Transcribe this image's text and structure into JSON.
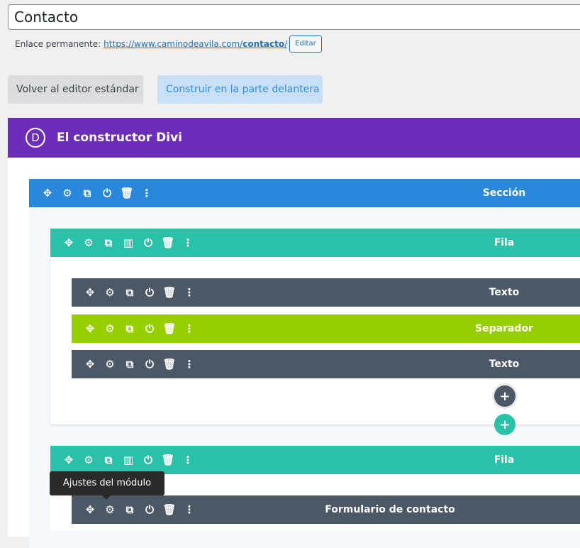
{
  "page_title": "Contacto",
  "permalink": {
    "label": "Enlace permanente:",
    "url_base": "https://www.caminodeavila.com/",
    "url_slug": "contacto",
    "url_end": "/",
    "edit_label": "Editar"
  },
  "buttons": {
    "standard_editor": "Volver al editor estándar",
    "front_builder": "Construir en la parte delantera"
  },
  "divi": {
    "logo_letter": "D",
    "title": "El constructor Divi",
    "section_label": "Sección",
    "row1_label": "Fila",
    "modules": [
      "Texto",
      "Separador",
      "Texto"
    ],
    "add_module": "+",
    "add_row": "+",
    "row2_label": "Fila",
    "tooltip": "Ajustes del módulo",
    "contact_form_label": "Formulario de contacto"
  },
  "icons": {
    "move": "✥",
    "settings": "⚙",
    "duplicate": "⧉",
    "columns": "▥",
    "save": "⏻",
    "delete": "🗑",
    "more": "⋮"
  },
  "colors": {
    "divi_purple": "#6c2eb9",
    "section_blue": "#2b87da",
    "row_teal": "#2bc0a8",
    "module_dark": "#4c5866",
    "separator_green": "#97ce00"
  }
}
